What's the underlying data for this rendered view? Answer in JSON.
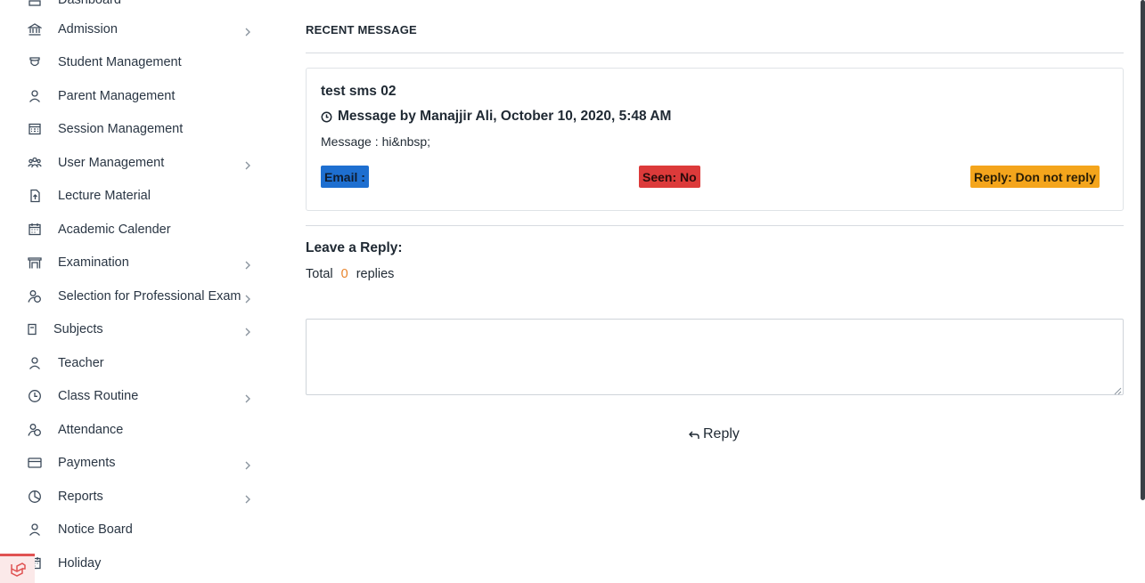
{
  "sidebar": {
    "items": [
      {
        "label": "Dashboard",
        "icon": "dashboard-icon",
        "submenu": false
      },
      {
        "label": "Admission",
        "icon": "bank-icon",
        "submenu": true
      },
      {
        "label": "Student Management",
        "icon": "graduation-cap-icon",
        "submenu": false
      },
      {
        "label": "Parent Management",
        "icon": "user-icon",
        "submenu": false
      },
      {
        "label": "Session Management",
        "icon": "calendar-grid-icon",
        "submenu": false
      },
      {
        "label": "User Management",
        "icon": "users-group-icon",
        "submenu": true
      },
      {
        "label": "Lecture Material",
        "icon": "file-upload-icon",
        "submenu": false
      },
      {
        "label": "Academic Calender",
        "icon": "calendar-icon",
        "submenu": false
      },
      {
        "label": "Examination",
        "icon": "building-icon",
        "submenu": true
      },
      {
        "label": "Selection for Professional Exam",
        "icon": "user-check-icon",
        "submenu": true
      },
      {
        "label": "Subjects",
        "icon": "book-icon",
        "submenu": true
      },
      {
        "label": "Teacher",
        "icon": "user-icon",
        "submenu": false
      },
      {
        "label": "Class Routine",
        "icon": "clock-icon",
        "submenu": true
      },
      {
        "label": "Attendance",
        "icon": "user-check-icon",
        "submenu": false
      },
      {
        "label": "Payments",
        "icon": "credit-card-icon",
        "submenu": true
      },
      {
        "label": "Reports",
        "icon": "pie-chart-icon",
        "submenu": true
      },
      {
        "label": "Notice Board",
        "icon": "user-icon",
        "submenu": false
      },
      {
        "label": "Holiday",
        "icon": "calendar-icon",
        "submenu": false
      }
    ]
  },
  "main": {
    "section_title": "RECENT MESSAGE",
    "message": {
      "subject": "test sms 02",
      "meta": "Message by Manajjir Ali, October 10, 2020, 5:48 AM",
      "body_label": "Message :",
      "body_text": "hi&nbsp;",
      "badges": {
        "email": "Email :",
        "seen": "Seen: No",
        "reply": "Reply: Don not reply"
      }
    },
    "reply_section": {
      "title": "Leave a Reply:",
      "total_label": "Total",
      "count": "0",
      "replies_label": "replies",
      "textarea_value": "",
      "button_label": "Reply"
    }
  },
  "colors": {
    "email_badge": "#1e6fd0",
    "seen_badge": "#dc3a3a",
    "reply_badge": "#f4a51c",
    "count_accent": "#e8832a",
    "laravel_red": "#e05252"
  }
}
